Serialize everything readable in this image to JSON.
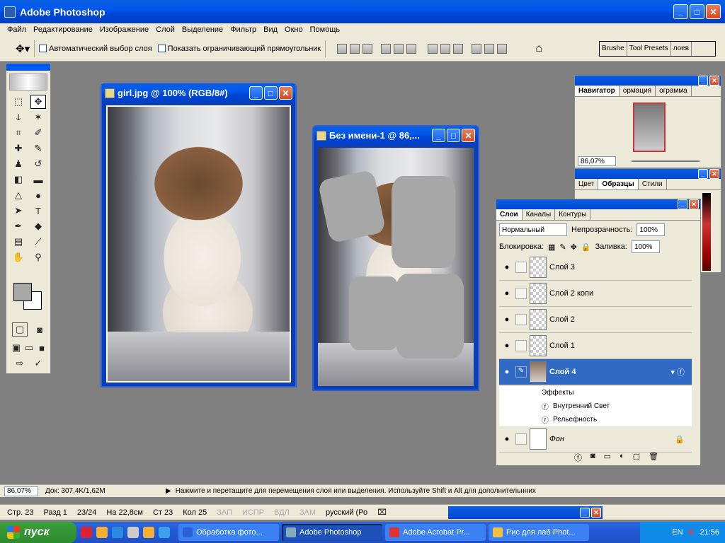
{
  "app": {
    "title": "Adobe Photoshop"
  },
  "menu": [
    "Файл",
    "Редактирование",
    "Изображение",
    "Слой",
    "Выделение",
    "Фильтр",
    "Вид",
    "Окно",
    "Помощь"
  ],
  "options": {
    "auto_select": "Автоматический выбор слоя",
    "show_bounds": "Показать ограничивающий прямоугольник"
  },
  "palette_well": [
    "Brushe",
    "Tool Presets",
    "лоев"
  ],
  "doc1": {
    "title": "girl.jpg @ 100% (RGB/8#)"
  },
  "doc2": {
    "title": "Без имени-1 @ 86,..."
  },
  "navigator": {
    "tabs": [
      "Навигатор",
      "ормация",
      "ограмма"
    ],
    "zoom": "86,07%"
  },
  "swatches": {
    "tabs": [
      "Цвет",
      "Образцы",
      "Стили"
    ]
  },
  "layers_panel": {
    "tabs": [
      "Слои",
      "Каналы",
      "Контуры"
    ],
    "blend_mode": "Нормальный",
    "opacity_label": "Непрозрачность:",
    "opacity": "100%",
    "lock_label": "Блокировка:",
    "fill_label": "Заливка:",
    "fill": "100%",
    "layers": [
      {
        "name": "Слой 3"
      },
      {
        "name": "Слой 2 копи"
      },
      {
        "name": "Слой 2"
      },
      {
        "name": "Слой 1"
      },
      {
        "name": "Слой 4"
      }
    ],
    "effects": [
      "Эффекты",
      "Внутренний Свет",
      "Рельефность"
    ],
    "background": "Фон"
  },
  "status": {
    "zoom": "86,07%",
    "doc": "Док: 307,4K/1,62M",
    "hint": "Нажмите и перетащите для перемещения слоя или выделения. Используйте Shift и Alt для дополнительнних"
  },
  "word_status": {
    "page": "Стр. 23",
    "section": "Разд 1",
    "pages": "23/24",
    "at": "На 22,8см",
    "line": "Ст 23",
    "col": "Кол 25",
    "rec": "ЗАП",
    "trk": "ИСПР",
    "ext": "ВДЛ",
    "ovr": "ЗАМ",
    "lang": "русский (Ро"
  },
  "taskbar": {
    "start": "пуск",
    "tasks": [
      "Обработка фото...",
      "Adobe Photoshop",
      "Adobe Acrobat Pr...",
      "Рис для лаб Phot..."
    ],
    "lang": "EN",
    "clock": "21:56"
  }
}
